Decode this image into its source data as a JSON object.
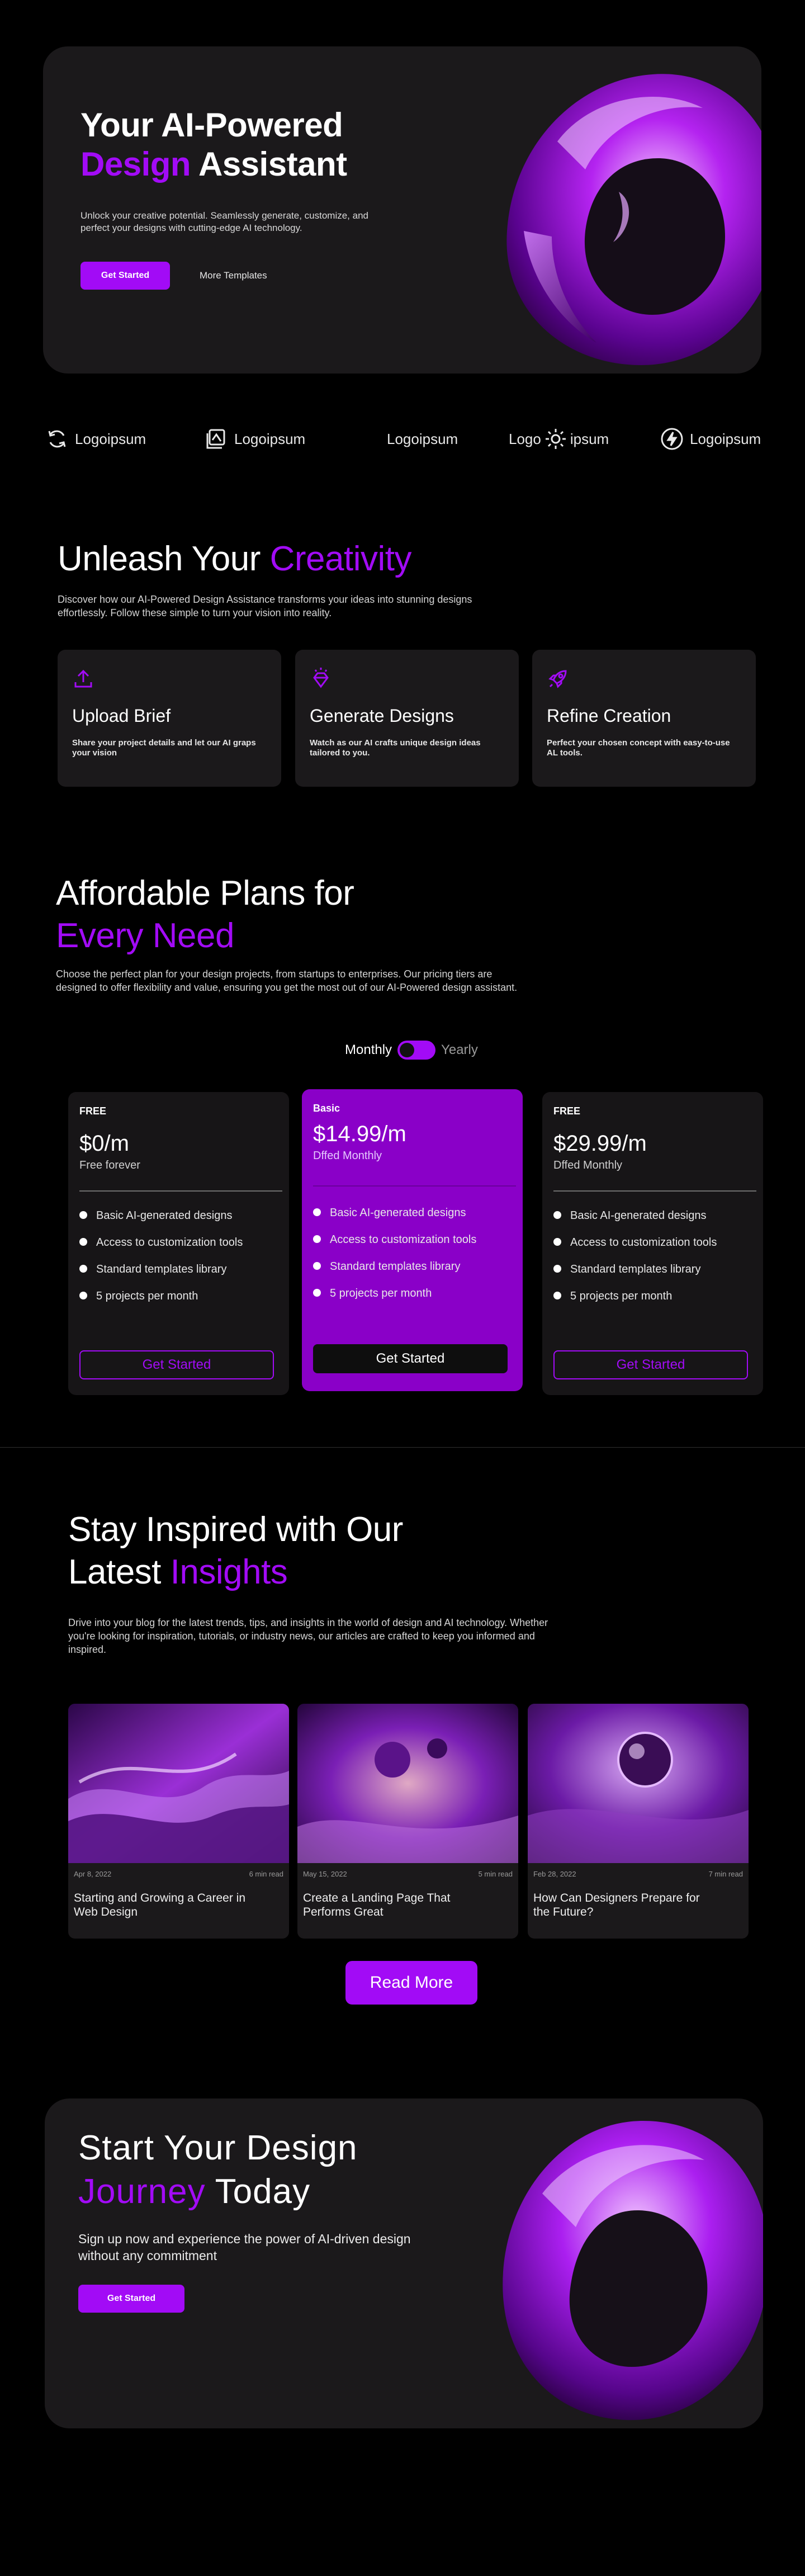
{
  "hero": {
    "title_line1": "Your AI-Powered",
    "title_accent": "Design",
    "title_rest": " Assistant",
    "description": "Unlock your creative potential. Seamlessly generate, customize, and perfect your designs with cutting-edge AI technology.",
    "primary_button": "Get Started",
    "secondary_link": "More Templates"
  },
  "logos": [
    {
      "name": "Logoipsum",
      "icon": "refresh-swirl-icon"
    },
    {
      "name": "Logoipsum",
      "icon": "stacked-card-icon"
    },
    {
      "name": "Logoipsum",
      "icon": ""
    },
    {
      "name_left": "Logo",
      "name_right": "ipsum",
      "icon": "gear-icon"
    },
    {
      "name": "Logoipsum",
      "icon": "lightning-circle-icon"
    }
  ],
  "creativity": {
    "title_plain": "Unleash Your ",
    "title_accent": "Creativity",
    "description": "Discover how our AI-Powered Design Assistance transforms your ideas into stunning designs effortlessly. Follow these simple to turn your vision into reality.",
    "features": [
      {
        "title": "Upload Brief",
        "text": "Share your project details and let our AI graps your vision",
        "icon": "upload-icon"
      },
      {
        "title": "Generate Designs",
        "text": "Watch as our AI crafts unique design ideas tailored to you.",
        "icon": "diamond-sparkle-icon"
      },
      {
        "title": "Refine Creation",
        "text": "Perfect your chosen concept with easy-to-use AL tools.",
        "icon": "rocket-icon"
      }
    ]
  },
  "pricing": {
    "title_line1": "Affordable Plans for",
    "title_accent": "Every Need",
    "description": "Choose the perfect plan for your design projects, from startups to enterprises. Our pricing tiers are designed to offer flexibility and value, ensuring you get the most out of our AI-Powered design assistant.",
    "toggle_left": "Monthly",
    "toggle_right": "Yearly",
    "plans": [
      {
        "tier": "FREE",
        "price": "$0/m",
        "sub": "Free forever",
        "features": [
          "Basic AI-generated designs",
          "Access to customization tools",
          "Standard templates library",
          "5 projects per month"
        ],
        "button": "Get Started"
      },
      {
        "tier": "Basic",
        "price": "$14.99/m",
        "sub": "Dffed Monthly",
        "features": [
          "Basic AI-generated designs",
          "Access to customization tools",
          "Standard templates library",
          "5 projects per month"
        ],
        "button": "Get Started"
      },
      {
        "tier": "FREE",
        "price": "$29.99/m",
        "sub": "Dffed Monthly",
        "features": [
          "Basic AI-generated designs",
          "Access to customization tools",
          "Standard templates library",
          "5 projects per month"
        ],
        "button": "Get Started"
      }
    ]
  },
  "blog": {
    "title_line1": "Stay Inspired with Our",
    "title_plain2": "Latest ",
    "title_accent": "Insights",
    "description": "Drive into your blog for the latest trends, tips, and  insights in the world of design and AI technology. Whether you're looking for inspiration, tutorials, or industry news, our articles are crafted to keep you informed and inspired.",
    "posts": [
      {
        "date": "Apr 8, 2022",
        "read": "6 min read",
        "title": "Starting and Growing a Career in Web Design"
      },
      {
        "date": "May 15, 2022",
        "read": "5 min read",
        "title": "Create a Landing Page That Performs Great"
      },
      {
        "date": "Feb 28, 2022",
        "read": "7 min read",
        "title": "How Can Designers Prepare for the Future?"
      }
    ],
    "read_more": "Read More"
  },
  "cta": {
    "title_line1": "Start Your Design",
    "title_accent": "Journey",
    "title_rest": " Today",
    "description": "Sign up now and experience the power of AI-driven design without any commitment",
    "button": "Get Started"
  },
  "colors": {
    "accent": "#a20bf6",
    "card": "#1b191b",
    "background": "#000000"
  }
}
